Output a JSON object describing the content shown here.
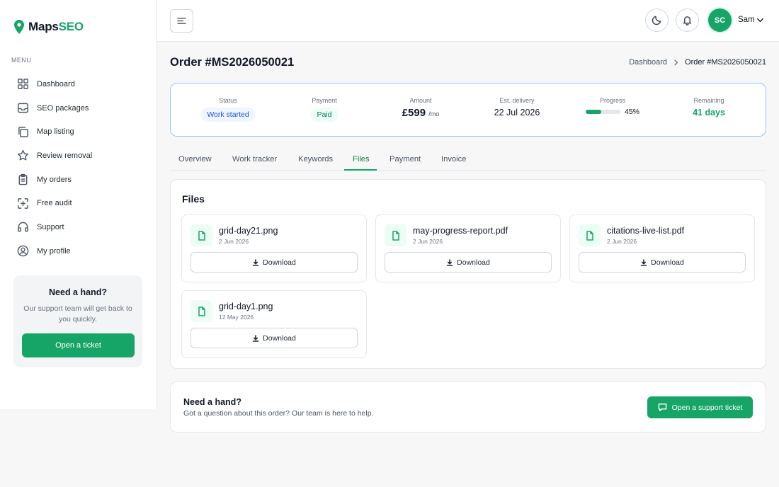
{
  "brand": {
    "name_a": "Maps",
    "name_b": "SEO",
    "accent_color": "#16a566"
  },
  "sidebar": {
    "menu_title": "MENU",
    "items": [
      {
        "label": "Dashboard",
        "icon": "grid-icon"
      },
      {
        "label": "SEO packages",
        "icon": "inbox-icon"
      },
      {
        "label": "Map listing",
        "icon": "copy-icon"
      },
      {
        "label": "Review removal",
        "icon": "star-icon"
      },
      {
        "label": "My orders",
        "icon": "clipboard-icon"
      },
      {
        "label": "Free audit",
        "icon": "scan-plus-icon"
      },
      {
        "label": "Support",
        "icon": "headphones-icon"
      },
      {
        "label": "My profile",
        "icon": "user-circle-icon"
      }
    ],
    "help": {
      "title": "Need a hand?",
      "text": "Our support team will get back to you quickly.",
      "button": "Open a ticket"
    }
  },
  "header": {
    "avatar_initials": "SC",
    "user_name": "Sam"
  },
  "page": {
    "title": "Order #MS2026050021",
    "breadcrumb": [
      "Dashboard",
      "Order #MS2026050021"
    ]
  },
  "summary": {
    "status_label": "Status",
    "status_value": "Work started",
    "payment_label": "Payment",
    "payment_value": "Paid",
    "amount_label": "Amount",
    "amount_value": "£599",
    "amount_unit": "/mo",
    "delivery_label": "Est. delivery",
    "delivery_value": "22 Jul 2026",
    "progress_label": "Progress",
    "progress_text": "45%",
    "progress_fraction": 0.45,
    "remaining_label": "Remaining",
    "remaining_value": "41 days"
  },
  "tabs": [
    "Overview",
    "Work tracker",
    "Keywords",
    "Files",
    "Payment",
    "Invoice"
  ],
  "active_tab": "Files",
  "files": {
    "title": "Files",
    "download_label": "Download",
    "items": [
      {
        "name": "grid-day21.png",
        "date": "2 Jun 2026"
      },
      {
        "name": "may-progress-report.pdf",
        "date": "2 Jun 2026"
      },
      {
        "name": "citations-live-list.pdf",
        "date": "2 Jun 2026"
      },
      {
        "name": "grid-day1.png",
        "date": "12 May 2026"
      }
    ]
  },
  "support": {
    "title": "Need a hand?",
    "text": "Got a question about this order? Our team is here to help.",
    "button": "Open a support ticket"
  }
}
